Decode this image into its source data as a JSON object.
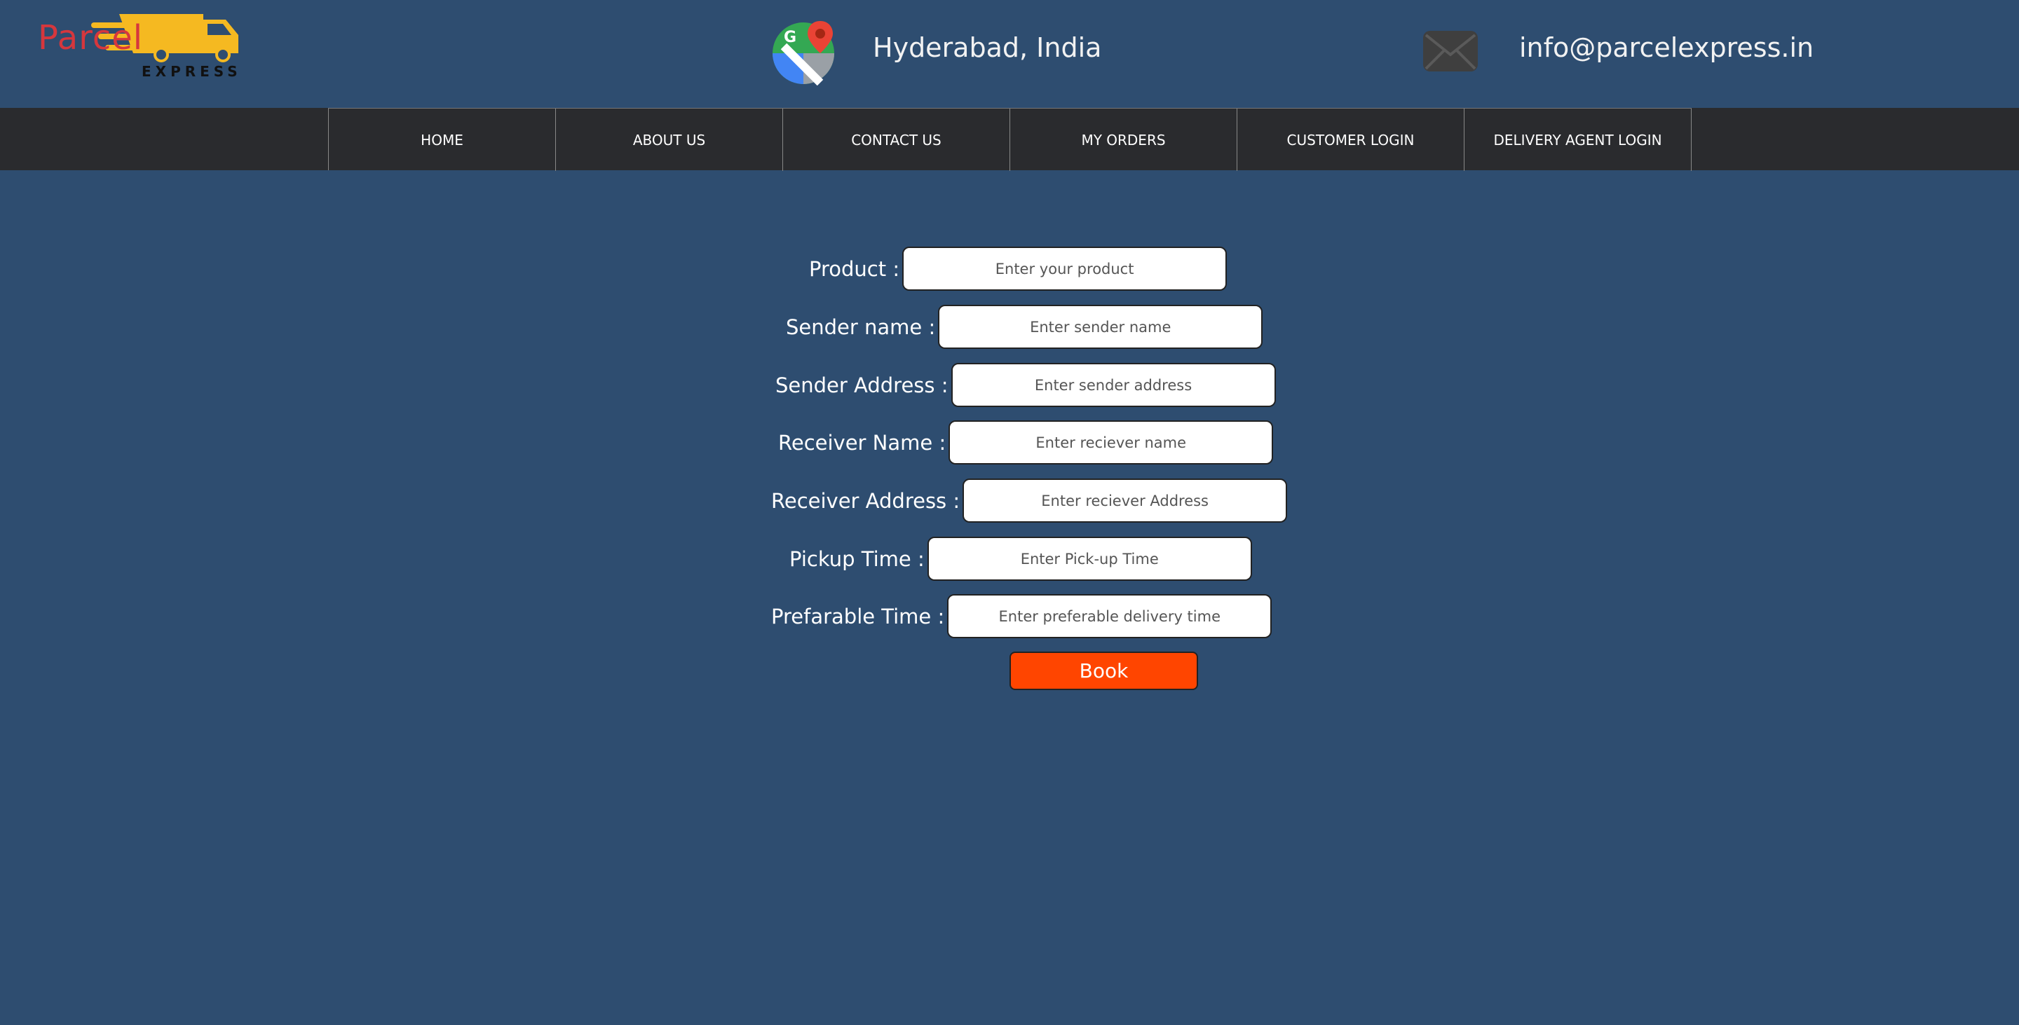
{
  "brand": {
    "logo_word": "Parcel",
    "logo_sub": "EXPRESS",
    "colors": {
      "red": "#d6373d",
      "truck_yellow": "#f5b921"
    }
  },
  "header": {
    "location": "Hyderabad, India",
    "email": "info@parcelexpress.in",
    "icons": [
      "google-maps-icon",
      "mail-icon"
    ]
  },
  "nav": {
    "items": [
      {
        "label": "HOME"
      },
      {
        "label": "ABOUT US"
      },
      {
        "label": "CONTACT US"
      },
      {
        "label": "MY ORDERS"
      },
      {
        "label": "CUSTOMER LOGIN"
      },
      {
        "label": "DELIVERY AGENT LOGIN"
      }
    ]
  },
  "form": {
    "fields": [
      {
        "label": "Product :",
        "placeholder": "Enter your product",
        "value": ""
      },
      {
        "label": "Sender name :",
        "placeholder": "Enter sender name",
        "value": ""
      },
      {
        "label": "Sender Address :",
        "placeholder": "Enter sender address",
        "value": ""
      },
      {
        "label": "Receiver Name :",
        "placeholder": "Enter reciever name",
        "value": ""
      },
      {
        "label": "Receiver Address :",
        "placeholder": "Enter reciever Address",
        "value": ""
      },
      {
        "label": "Pickup Time :",
        "placeholder": "Enter Pick-up Time",
        "value": ""
      },
      {
        "label": "Prefarable Time :",
        "placeholder": "Enter preferable delivery time",
        "value": ""
      }
    ],
    "submit_label": "Book"
  },
  "colors": {
    "page_bg": "#2e4d70",
    "nav_bg": "#2a2b2e",
    "button_bg": "#ff4500"
  }
}
